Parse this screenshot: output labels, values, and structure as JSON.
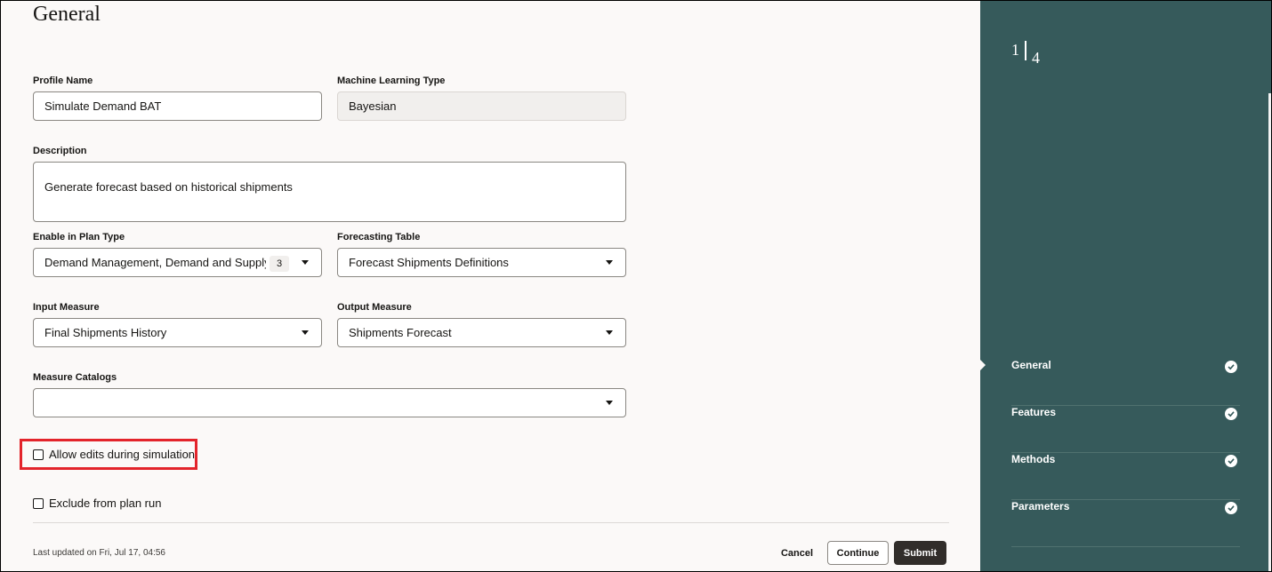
{
  "page": {
    "title": "General"
  },
  "form": {
    "profile_name": {
      "label": "Profile Name",
      "value": "Simulate Demand BAT"
    },
    "ml_type": {
      "label": "Machine Learning Type",
      "value": "Bayesian"
    },
    "description": {
      "label": "Description",
      "value": "Generate forecast based on historical shipments"
    },
    "plan_type": {
      "label": "Enable in Plan Type",
      "value": "Demand Management, Demand and Supply Pl",
      "count": "3"
    },
    "forecasting_table": {
      "label": "Forecasting Table",
      "value": "Forecast Shipments Definitions"
    },
    "input_measure": {
      "label": "Input Measure",
      "value": "Final Shipments History"
    },
    "output_measure": {
      "label": "Output Measure",
      "value": "Shipments Forecast"
    },
    "measure_catalogs": {
      "label": "Measure Catalogs",
      "value": ""
    },
    "allow_edits": {
      "label": "Allow edits during simulation",
      "checked": false
    },
    "exclude_plan_run": {
      "label": "Exclude from plan run",
      "checked": false
    }
  },
  "footer": {
    "last_updated": "Last updated on Fri, Jul 17, 04:56",
    "cancel_label": "Cancel",
    "continue_label": "Continue",
    "submit_label": "Submit"
  },
  "sidebar": {
    "current_step": "1",
    "total_steps": "4",
    "steps": [
      {
        "label": "General",
        "complete": true
      },
      {
        "label": "Features",
        "complete": true
      },
      {
        "label": "Methods",
        "complete": true
      },
      {
        "label": "Parameters",
        "complete": true
      }
    ]
  },
  "colors": {
    "sidebar_bg": "#365a5b",
    "highlight": "#e3242b",
    "submit_bg": "#312d2a"
  }
}
